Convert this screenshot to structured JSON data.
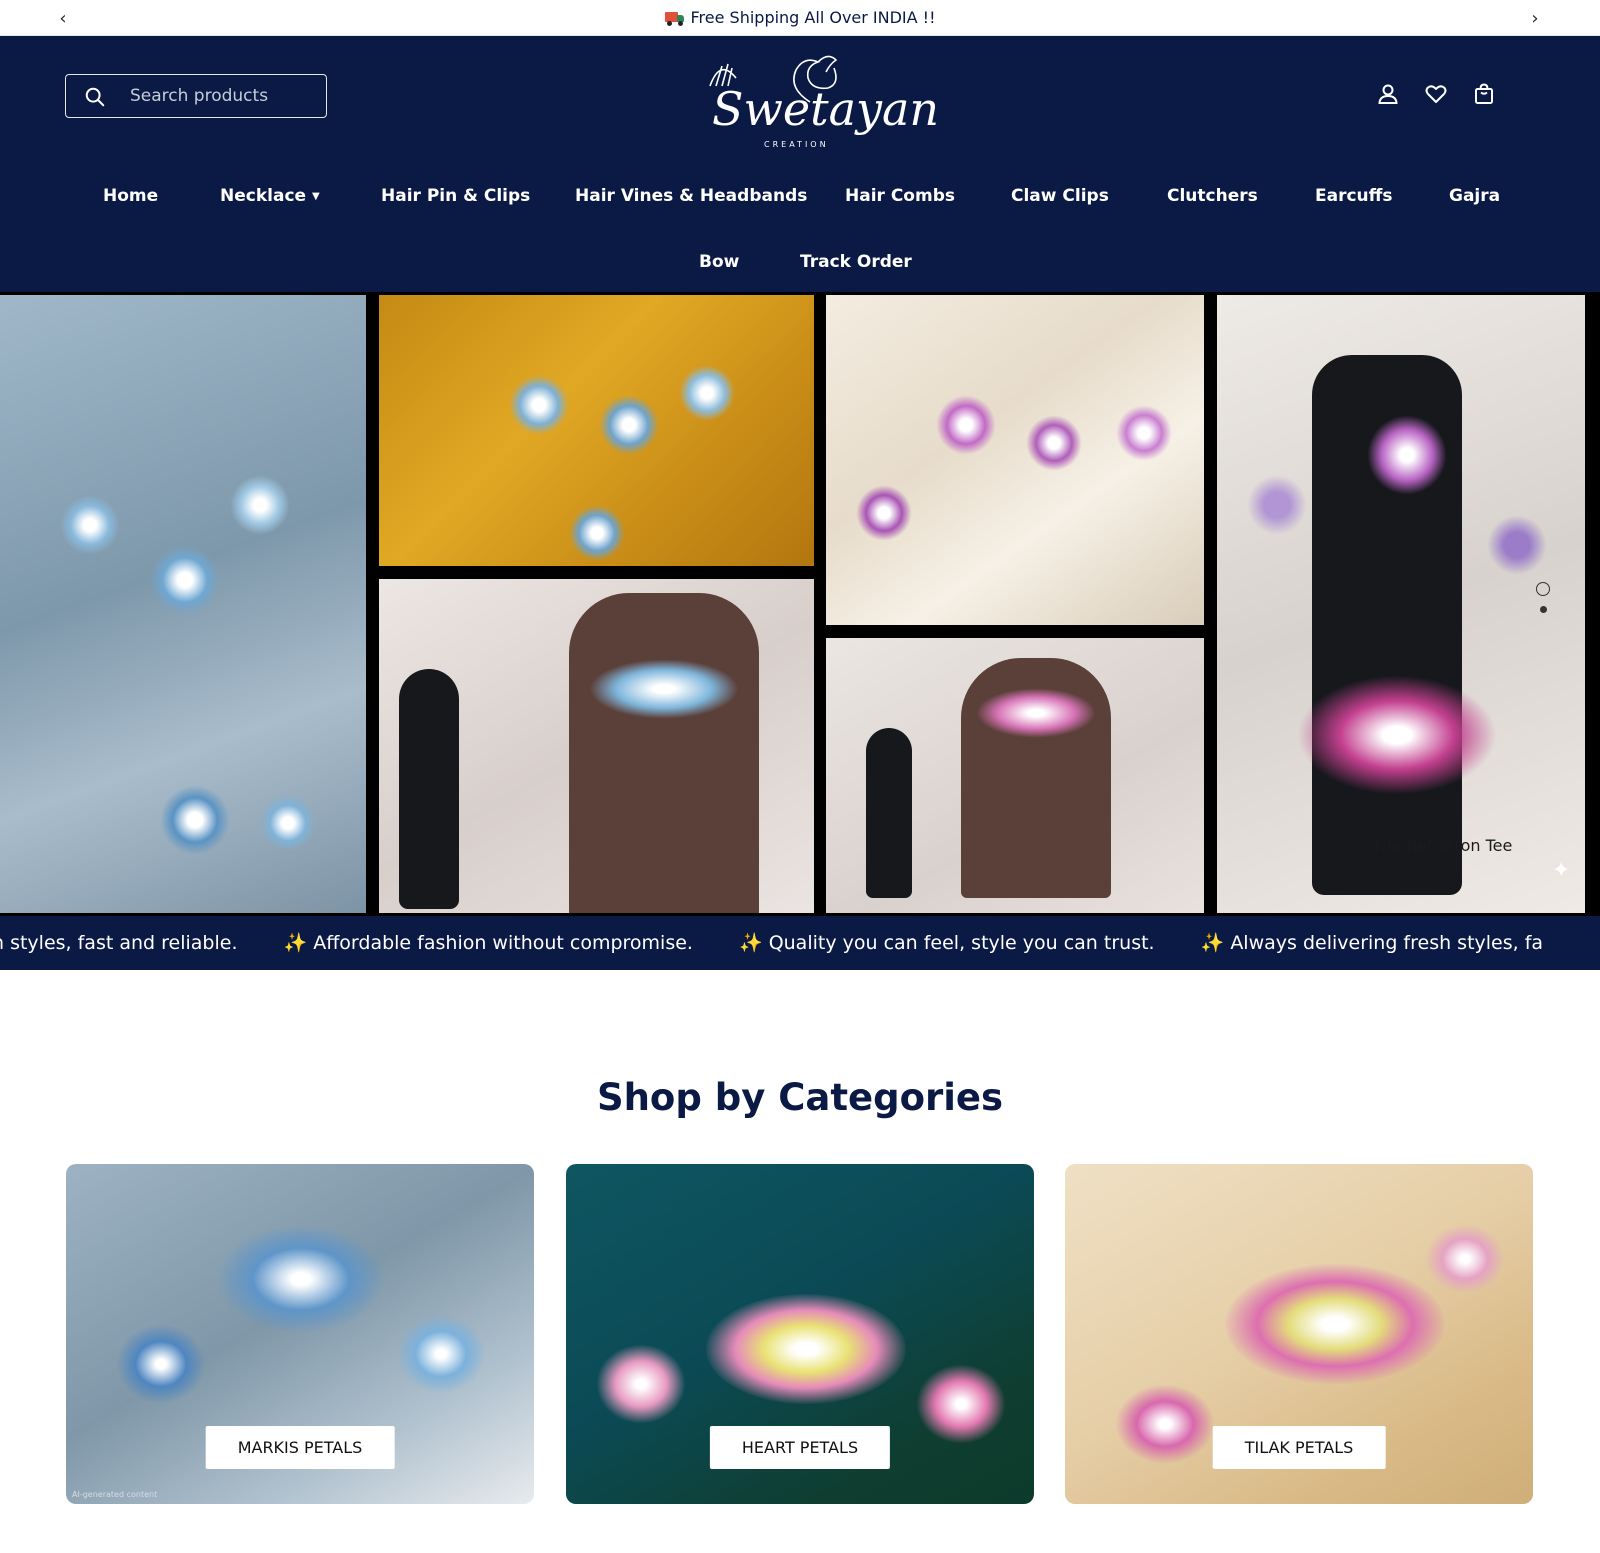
{
  "announcement": {
    "text": "Free Shipping All Over INDIA !!",
    "prev_arrow": "‹",
    "next_arrow": "›"
  },
  "header": {
    "search_placeholder": "Search products",
    "logo_text": "Swetayan",
    "logo_subtext": "CREATION",
    "icons": [
      "account-icon",
      "heart-icon",
      "cart-icon"
    ]
  },
  "nav": {
    "items": [
      {
        "label": "Home"
      },
      {
        "label": "Necklace",
        "has_dropdown": true
      },
      {
        "label": "Hair Pin & Clips"
      },
      {
        "label": "Hair Vines & Headbands"
      },
      {
        "label": "Hair Combs"
      },
      {
        "label": "Claw Clips"
      },
      {
        "label": "Clutchers"
      },
      {
        "label": "Earcuffs"
      },
      {
        "label": "Gajra"
      },
      {
        "label": "Bow"
      },
      {
        "label": "Track Order"
      }
    ]
  },
  "hero": {
    "caption": "The ReCotton Tee"
  },
  "marquee": {
    "items": [
      "h styles, fast and reliable.",
      "Affordable fashion without compromise.",
      "Quality you can feel, style you can trust.",
      "Always delivering fresh styles, fa"
    ],
    "star": "✨"
  },
  "categories": {
    "title": "Shop by Categories",
    "cards": [
      {
        "label": "MARKIS PETALS"
      },
      {
        "label": "HEART PETALS"
      },
      {
        "label": "TILAK PETALS"
      }
    ],
    "ai_note": "AI-generated content"
  },
  "colors": {
    "brand_navy": "#0b1a45",
    "white": "#ffffff"
  }
}
